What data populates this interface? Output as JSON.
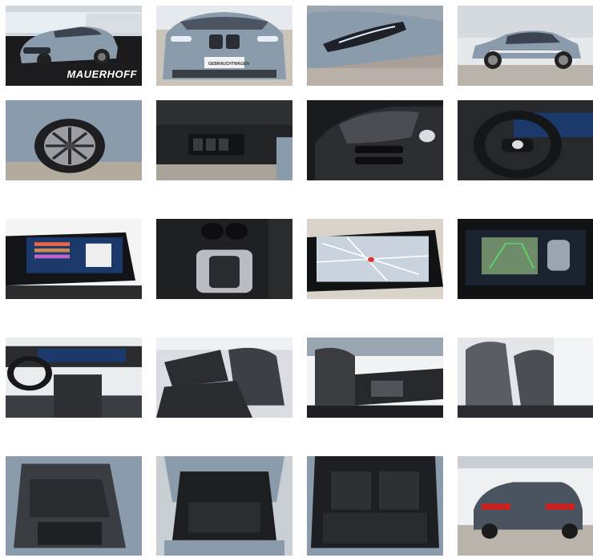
{
  "gallery": {
    "watermark_brand": "MAUERHOFF",
    "badge_text": "GEBRAUCHTWAGEN",
    "colors": {
      "car_body": "#8a9bab",
      "car_body_light": "#a9b6c2",
      "interior_dark": "#1c1d20",
      "interior_grey": "#5a5d62",
      "tile_sky": "#e8ecef",
      "pavement": "#b7b0a6",
      "screen_blue": "#1b3a6b"
    },
    "tiles": [
      {
        "icon": "car-front-three-quarter-icon"
      },
      {
        "icon": "car-front-icon"
      },
      {
        "icon": "headlight-icon"
      },
      {
        "icon": "car-side-icon"
      },
      {
        "icon": "wheel-icon"
      },
      {
        "icon": "door-panel-icon"
      },
      {
        "icon": "vent-icon"
      },
      {
        "icon": "steering-wheel-icon"
      },
      {
        "icon": "infotainment-screen-icon"
      },
      {
        "icon": "gear-selector-icon"
      },
      {
        "icon": "navigation-map-icon"
      },
      {
        "icon": "parking-camera-icon"
      },
      {
        "icon": "dashboard-icon"
      },
      {
        "icon": "front-seats-icon"
      },
      {
        "icon": "passenger-seat-icon"
      },
      {
        "icon": "seat-side-icon"
      },
      {
        "icon": "rear-seats-icon"
      },
      {
        "icon": "trunk-open-icon"
      },
      {
        "icon": "trunk-space-icon"
      },
      {
        "icon": "car-rear-icon"
      }
    ]
  }
}
